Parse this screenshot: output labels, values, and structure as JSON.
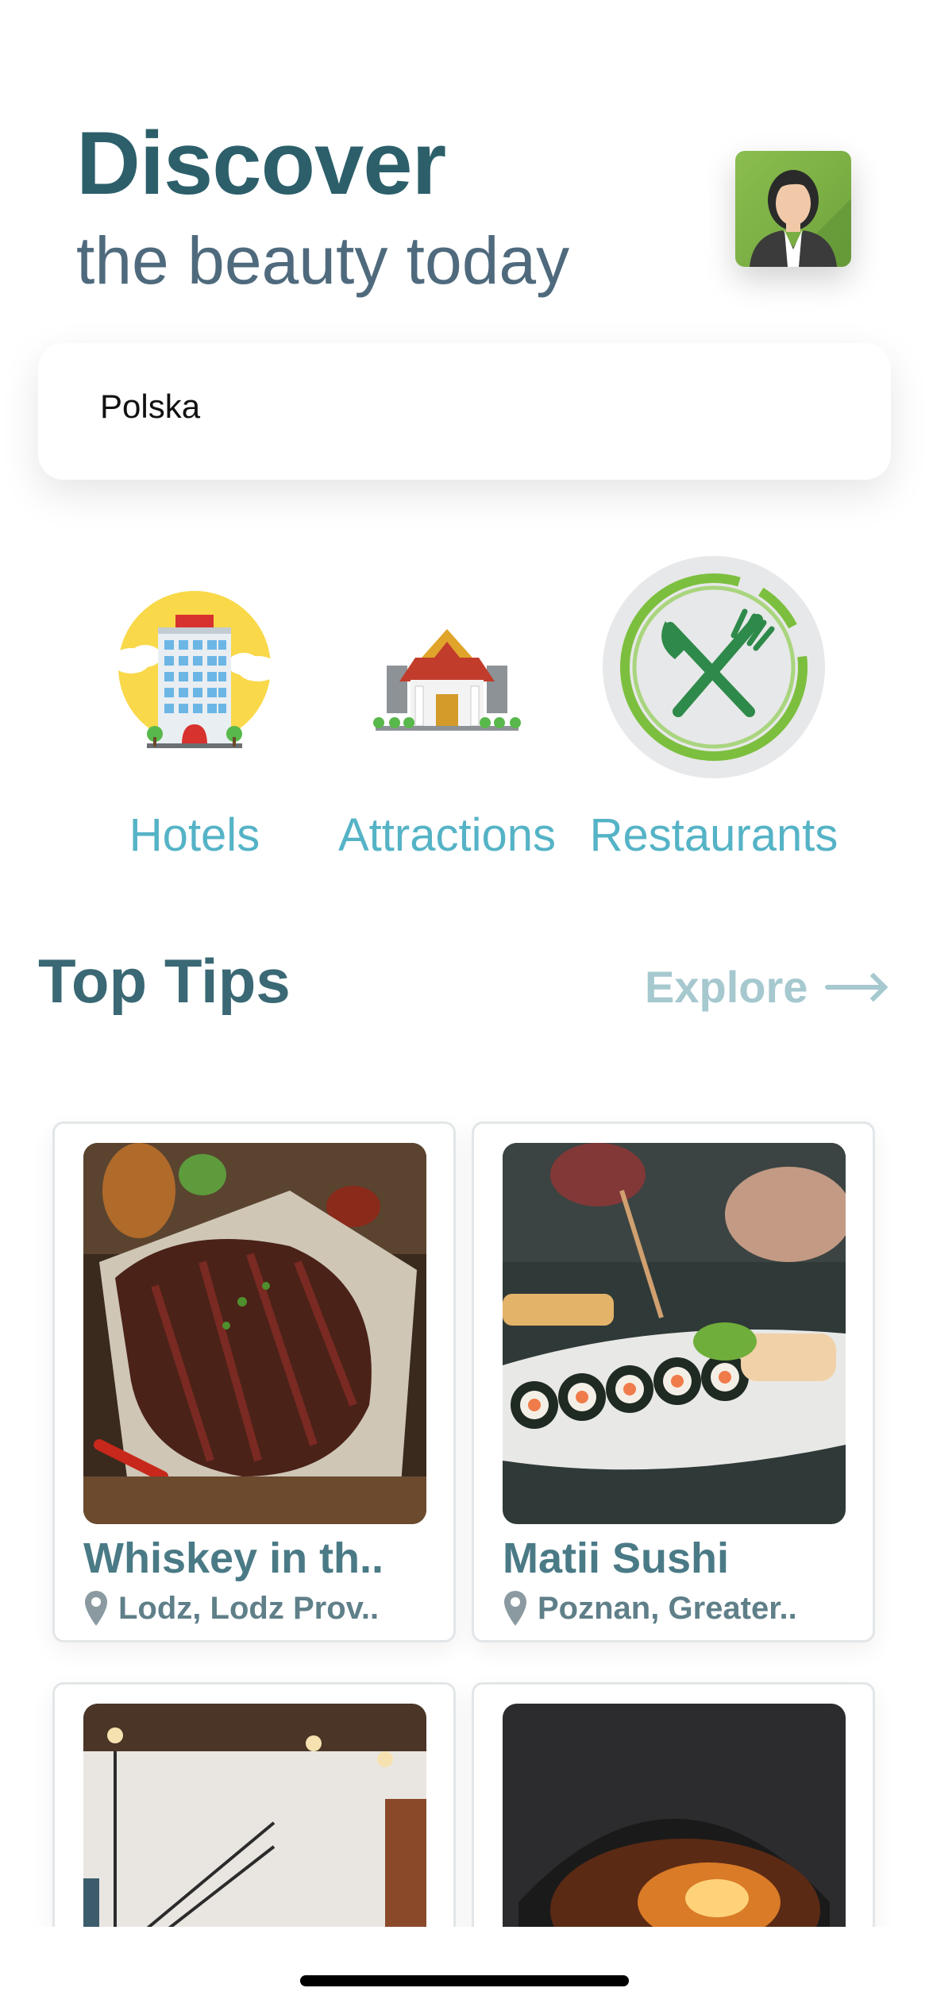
{
  "header": {
    "title": "Discover",
    "subtitle": "the beauty today"
  },
  "search": {
    "value": "Polska"
  },
  "categories": [
    {
      "label": "Hotels",
      "icon": "hotel-icon"
    },
    {
      "label": "Attractions",
      "icon": "temple-icon"
    },
    {
      "label": "Restaurants",
      "icon": "restaurant-icon",
      "selected": true
    }
  ],
  "section": {
    "title": "Top Tips",
    "explore_label": "Explore"
  },
  "cards": [
    {
      "name": "Whiskey in th..",
      "location": "Lodz, Lodz Prov.."
    },
    {
      "name": "Matii Sushi",
      "location": "Poznan, Greater.."
    },
    {
      "name": "",
      "location": ""
    },
    {
      "name": "",
      "location": ""
    }
  ],
  "colors": {
    "title": "#2c5f6a",
    "subtitle": "#4f6a7d",
    "category_label": "#55b3c6",
    "explore": "#a6c8cf",
    "card_name": "#4a7a86",
    "restaurant_green": "#2e8a4a"
  }
}
